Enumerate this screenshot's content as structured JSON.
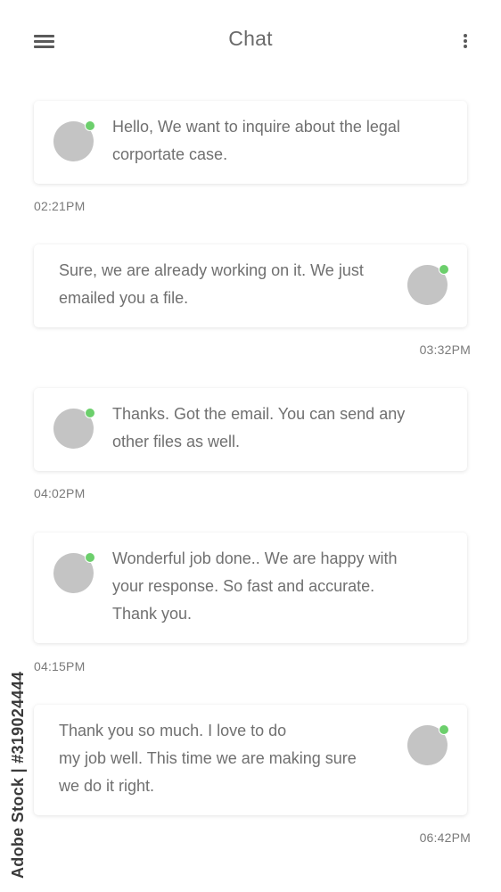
{
  "header": {
    "title": "Chat",
    "menu_icon": "hamburger-menu-icon",
    "more_icon": "vertical-dots-icon"
  },
  "colors": {
    "avatar": "#c4c4c4",
    "online_status": "#6ccf6c",
    "text": "#707070"
  },
  "messages": [
    {
      "direction": "incoming",
      "text": "Hello, We want to inquire about the legal\ncorportate case.",
      "time": "02:21PM"
    },
    {
      "direction": "outgoing",
      "text": "Sure, we are already working on it. We just\nemailed you a file.",
      "time": "03:32PM"
    },
    {
      "direction": "incoming",
      "text": "Thanks. Got the email. You can send any\nother files as well.",
      "time": "04:02PM"
    },
    {
      "direction": "incoming",
      "text": "Wonderful job done.. We are happy with\nyour response. So fast and accurate.\nThank you.",
      "time": "04:15PM"
    },
    {
      "direction": "outgoing",
      "text": "Thank you so much. I love to do\nmy job well. This time we are making sure\nwe do it right.",
      "time": "06:42PM"
    }
  ],
  "watermark": "Adobe Stock | #319024444"
}
